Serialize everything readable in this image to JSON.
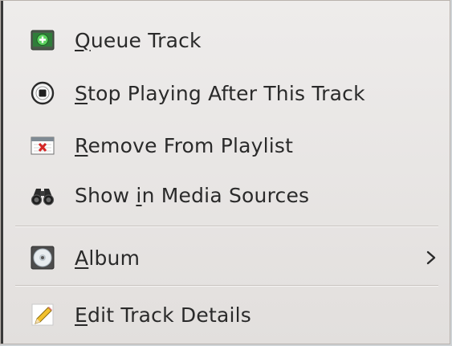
{
  "menu": {
    "items": [
      {
        "label": "Queue Track",
        "mnemonic_index": 0,
        "icon": "queue-track-icon"
      },
      {
        "label": "Stop Playing After This Track",
        "mnemonic_index": 0,
        "icon": "stop-icon"
      },
      {
        "label": "Remove From Playlist",
        "mnemonic_index": 0,
        "icon": "remove-playlist-icon"
      },
      {
        "label": "Show in Media Sources",
        "mnemonic_index": 5,
        "icon": "binoculars-icon"
      },
      {
        "label": "Album",
        "mnemonic_index": 0,
        "icon": "album-cd-icon",
        "submenu": true
      },
      {
        "label": "Edit Track Details",
        "mnemonic_index": 0,
        "icon": "pencil-icon"
      }
    ]
  },
  "colors": {
    "menu_bg_top": "#eeeceb",
    "menu_bg_bottom": "#e2dfdd",
    "text": "#2a2a2a",
    "separator": "#c8c3bf"
  }
}
